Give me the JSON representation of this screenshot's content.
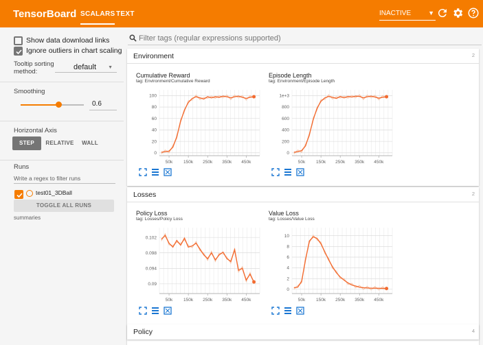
{
  "header": {
    "brand": "TensorBoard",
    "tabs": [
      {
        "label": "SCALARS"
      },
      {
        "label": "TEXT"
      }
    ],
    "status_select": "INACTIVE",
    "accent": "#f57c00"
  },
  "sidebar": {
    "show_download_label": "Show data download links",
    "ignore_outliers_label": "Ignore outliers in chart scaling",
    "tooltip_sorting_label": "Tooltip sorting method:",
    "tooltip_sorting_value": "default",
    "smoothing_label": "Smoothing",
    "smoothing_value": "0.6",
    "smoothing_fraction": 0.6,
    "horizontal_axis_label": "Horizontal Axis",
    "axis_options": [
      "STEP",
      "RELATIVE",
      "WALL"
    ],
    "runs_label": "Runs",
    "runs_filter_placeholder": "Write a regex to filter runs",
    "run_name": "test01_3DBall",
    "toggle_all_label": "TOGGLE ALL RUNS",
    "summaries_label": "summaries"
  },
  "main": {
    "search_placeholder": "Filter tags (regular expressions supported)",
    "categories": [
      {
        "title": "Environment",
        "count": "2"
      },
      {
        "title": "Losses",
        "count": "2"
      },
      {
        "title": "Policy",
        "count": "4"
      }
    ],
    "cards": [
      {
        "title": "Cumulative Reward",
        "tag": "tag: Environment/Cumulative Reward"
      },
      {
        "title": "Episode Length",
        "tag": "tag: Environment/Episode Length"
      },
      {
        "title": "Policy Loss",
        "tag": "tag: Losses/Policy Loss"
      },
      {
        "title": "Value Loss",
        "tag": "tag: Losses/Value Loss"
      }
    ]
  },
  "chart_data": [
    {
      "type": "line",
      "title": "Cumulative Reward",
      "xticks": [
        "50k",
        "150k",
        "250k",
        "350k",
        "450k"
      ],
      "yticks": [
        "0",
        "20",
        "40",
        "60",
        "80",
        "100"
      ],
      "xlim": [
        0,
        520000
      ],
      "ylim": [
        -5,
        110
      ],
      "series": [
        {
          "x": [
            10000,
            30000,
            50000,
            70000,
            90000,
            110000,
            130000,
            150000,
            170000,
            190000,
            210000,
            230000,
            250000,
            270000,
            290000,
            310000,
            330000,
            350000,
            370000,
            390000,
            410000,
            430000,
            450000,
            470000,
            490000
          ],
          "values": [
            1,
            2,
            3,
            10,
            28,
            55,
            75,
            88,
            95,
            98,
            96,
            94,
            98,
            96,
            98,
            97,
            99,
            98,
            96,
            98,
            99,
            97,
            95,
            97,
            98
          ]
        }
      ]
    },
    {
      "type": "line",
      "title": "Episode Length",
      "xticks": [
        "50k",
        "150k",
        "250k",
        "350k",
        "450k"
      ],
      "yticks": [
        "0",
        "200",
        "400",
        "600",
        "800",
        "1e+3"
      ],
      "xlim": [
        0,
        520000
      ],
      "ylim": [
        -50,
        1100
      ],
      "series": [
        {
          "x": [
            10000,
            30000,
            50000,
            70000,
            90000,
            110000,
            130000,
            150000,
            170000,
            190000,
            210000,
            230000,
            250000,
            270000,
            290000,
            310000,
            330000,
            350000,
            370000,
            390000,
            410000,
            430000,
            450000,
            470000,
            490000
          ],
          "values": [
            10,
            20,
            40,
            120,
            320,
            580,
            780,
            900,
            960,
            985,
            970,
            950,
            985,
            960,
            985,
            975,
            990,
            985,
            960,
            980,
            990,
            975,
            955,
            970,
            980
          ]
        }
      ]
    },
    {
      "type": "line",
      "title": "Policy Loss",
      "xticks": [
        "50k",
        "150k",
        "250k",
        "350k",
        "450k"
      ],
      "yticks": [
        "0.09",
        "0.094",
        "0.098",
        "0.102"
      ],
      "xlim": [
        0,
        520000
      ],
      "ylim": [
        0.0875,
        0.1045
      ],
      "series": [
        {
          "x": [
            10000,
            30000,
            50000,
            70000,
            90000,
            110000,
            130000,
            150000,
            170000,
            190000,
            210000,
            230000,
            250000,
            270000,
            290000,
            310000,
            330000,
            350000,
            370000,
            390000,
            410000,
            430000,
            450000,
            470000,
            490000
          ],
          "values": [
            0.1015,
            0.1025,
            0.1005,
            0.0995,
            0.1012,
            0.1,
            0.1018,
            0.0995,
            0.0998,
            0.1005,
            0.099,
            0.0975,
            0.0965,
            0.098,
            0.0962,
            0.0975,
            0.0982,
            0.0965,
            0.0958,
            0.0988,
            0.0935,
            0.094,
            0.091,
            0.0925,
            0.0905
          ]
        }
      ]
    },
    {
      "type": "line",
      "title": "Value Loss",
      "xticks": [
        "50k",
        "150k",
        "250k",
        "350k",
        "450k"
      ],
      "yticks": [
        "0",
        "2",
        "4",
        "6",
        "8",
        "10"
      ],
      "xlim": [
        0,
        520000
      ],
      "ylim": [
        -0.8,
        11.5
      ],
      "series": [
        {
          "x": [
            10000,
            30000,
            50000,
            70000,
            90000,
            110000,
            130000,
            150000,
            170000,
            190000,
            210000,
            230000,
            250000,
            270000,
            290000,
            310000,
            330000,
            350000,
            370000,
            390000,
            410000,
            430000,
            450000,
            470000,
            490000
          ],
          "values": [
            0.3,
            0.4,
            1.5,
            5.5,
            9.0,
            9.8,
            9.5,
            8.5,
            7.0,
            5.5,
            4.2,
            3.1,
            2.3,
            1.7,
            1.2,
            0.8,
            0.6,
            0.4,
            0.3,
            0.25,
            0.2,
            0.2,
            0.18,
            0.16,
            0.15
          ]
        }
      ]
    }
  ]
}
